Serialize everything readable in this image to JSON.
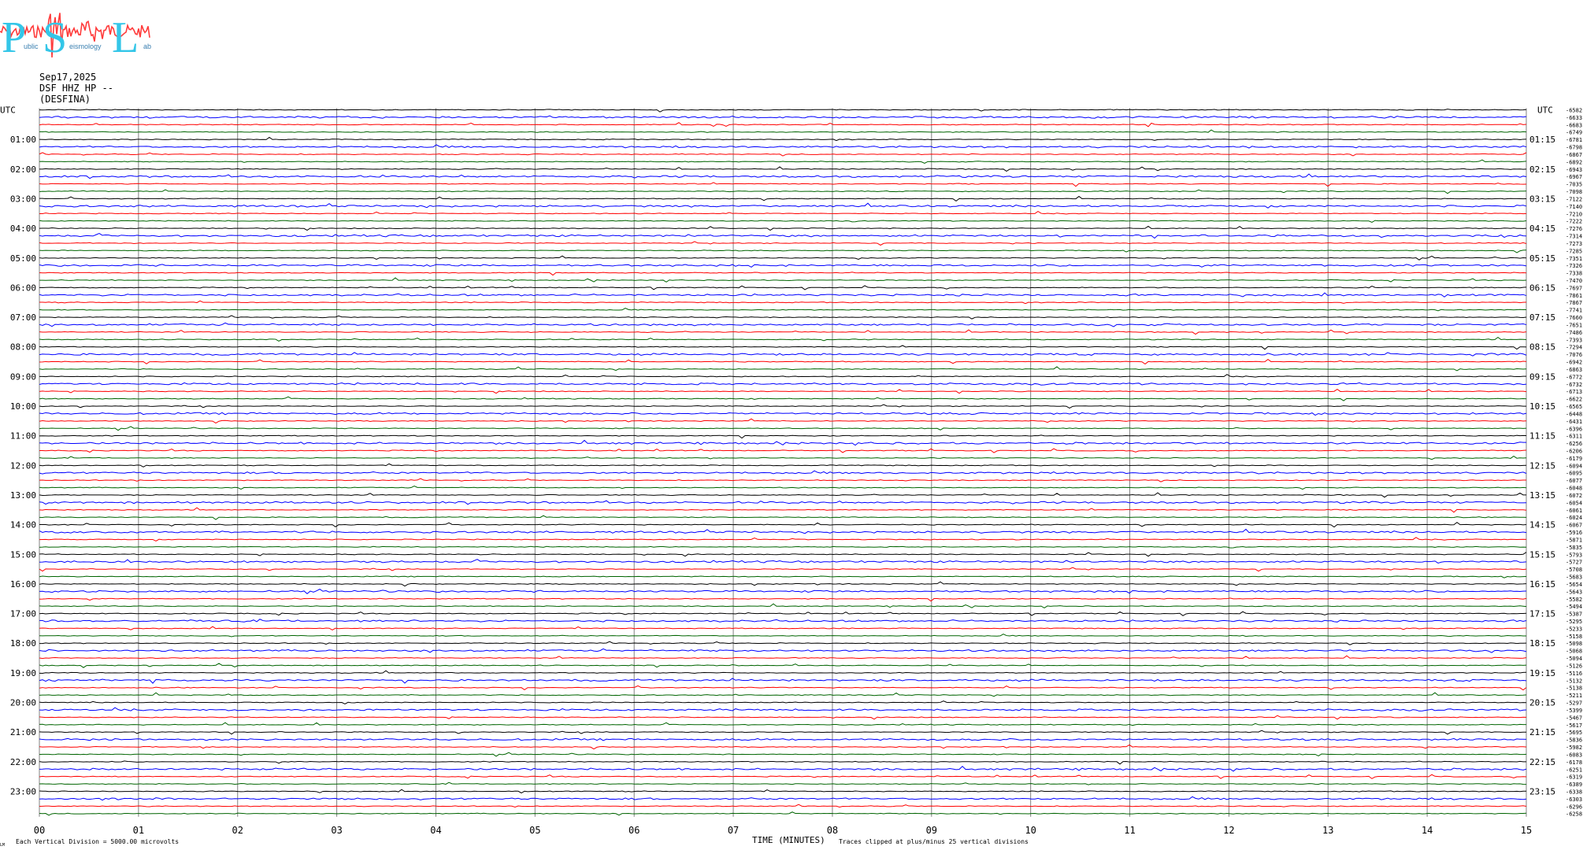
{
  "logo": {
    "letters": [
      "P",
      "S",
      "L"
    ],
    "words": [
      "ublic",
      "eismology",
      "ab"
    ],
    "colors": {
      "letters": "#33c6e8",
      "waveform": "#ff3b3b"
    }
  },
  "header": {
    "date": "Sep17,2025",
    "station": "DSF HHZ HP --",
    "site": "(DESFINA)"
  },
  "chart_data": {
    "type": "line",
    "title": "",
    "xlabel": "TIME (MINUTES)",
    "ylabel": "UTC",
    "ylabel_right": "UTC",
    "xlim": [
      0,
      15
    ],
    "x_ticks": [
      "00",
      "01",
      "02",
      "03",
      "04",
      "05",
      "06",
      "07",
      "08",
      "09",
      "10",
      "11",
      "12",
      "13",
      "14",
      "15"
    ],
    "trace_count": 96,
    "trace_color_cycle": [
      "#000000",
      "#0000ff",
      "#ff0000",
      "#006400"
    ],
    "left_hour_labels": [
      "01:00",
      "02:00",
      "03:00",
      "04:00",
      "05:00",
      "06:00",
      "07:00",
      "08:00",
      "09:00",
      "10:00",
      "11:00",
      "12:00",
      "13:00",
      "14:00",
      "15:00",
      "16:00",
      "17:00",
      "18:00",
      "19:00",
      "20:00",
      "21:00",
      "22:00",
      "23:00"
    ],
    "right_hour_labels": [
      "01:15",
      "02:15",
      "03:15",
      "04:15",
      "05:15",
      "06:15",
      "07:15",
      "08:15",
      "09:15",
      "10:15",
      "11:15",
      "12:15",
      "13:15",
      "14:15",
      "15:15",
      "16:15",
      "17:15",
      "18:15",
      "19:15",
      "20:15",
      "21:15",
      "22:15",
      "23:15"
    ],
    "trace_offsets": [
      "-6582",
      "-6633",
      "-6683",
      "-6749",
      "-6781",
      "-6798",
      "-6867",
      "-6892",
      "-6943",
      "-6967",
      "-7035",
      "-7098",
      "-7122",
      "-7140",
      "-7210",
      "-7222",
      "-7276",
      "-7314",
      "-7273",
      "-7285",
      "-7351",
      "-7326",
      "-7338",
      "-7470",
      "-7697",
      "-7861",
      "-7867",
      "-7741",
      "-7660",
      "-7651",
      "-7486",
      "-7393",
      "-7294",
      "-7076",
      "-6942",
      "-6863",
      "-6772",
      "-6732",
      "-6713",
      "-6622",
      "-6565",
      "-6448",
      "-6431",
      "-6396",
      "-6311",
      "-6256",
      "-6206",
      "-6179",
      "-6094",
      "-6095",
      "-6077",
      "-6048",
      "-6072",
      "-6054",
      "-6061",
      "-6024",
      "-6067",
      "-5916",
      "-5871",
      "-5835",
      "-5793",
      "-5727",
      "-5708",
      "-5683",
      "-5654",
      "-5643",
      "-5582",
      "-5494",
      "-5387",
      "-5295",
      "-5233",
      "-5158",
      "-5098",
      "-5068",
      "-5094",
      "-5126",
      "-5116",
      "-5132",
      "-5138",
      "-5211",
      "-5297",
      "-5399",
      "-5467",
      "-5617",
      "-5695",
      "-5836",
      "-5982",
      "-6083",
      "-6178",
      "-6251",
      "-6319",
      "-6389",
      "-6338",
      "-6303",
      "-6296",
      "-6258"
    ],
    "annotations": {
      "scale": "Each Vertical Division = 5000.00 microvolts",
      "clip": "Traces clipped at plus/minus 25 vertical divisions"
    },
    "grid": true
  },
  "footer": {
    "corner_mark": "LM"
  }
}
